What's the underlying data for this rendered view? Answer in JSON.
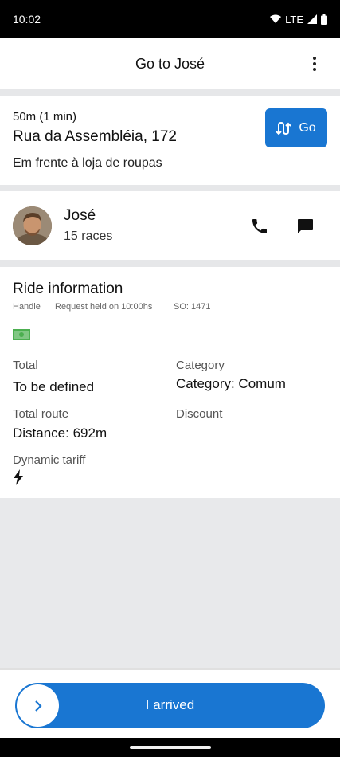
{
  "status_bar": {
    "time": "10:02",
    "network": "LTE"
  },
  "app_bar": {
    "title": "Go to José"
  },
  "destination": {
    "eta": "50m (1 min)",
    "street": "Rua da Assembléia, 172",
    "reference": "Em frente à loja de roupas",
    "go_label": "Go"
  },
  "driver": {
    "name": "José",
    "races": "15 races"
  },
  "ride_info": {
    "title": "Ride information",
    "meta": {
      "handle": "Handle",
      "request": "Request held on 10:00hs",
      "so": "SO: 1471"
    },
    "payment_icon": "cash-icon",
    "total": {
      "label": "Total",
      "value": "To be defined"
    },
    "category": {
      "label": "Category",
      "value": "Category: Comum"
    },
    "total_route": {
      "label": "Total route",
      "value": "Distance: 692m"
    },
    "discount": {
      "label": "Discount"
    },
    "dynamic_tariff": {
      "label": "Dynamic tariff",
      "icon": "bolt-icon"
    }
  },
  "action": {
    "slider_label": "I arrived"
  },
  "colors": {
    "primary": "#1976d2",
    "divider": "#e6e7e9",
    "cash": "#4caf50"
  }
}
